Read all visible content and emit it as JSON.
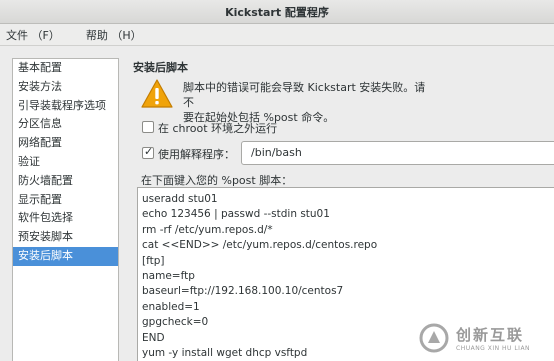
{
  "window": {
    "title": "Kickstart 配置程序"
  },
  "menu": [
    {
      "label": "文件 （F）"
    },
    {
      "label": "帮助 （H）"
    }
  ],
  "sidebar": {
    "items": [
      {
        "label": "基本配置"
      },
      {
        "label": "安装方法"
      },
      {
        "label": "引导装载程序选项"
      },
      {
        "label": "分区信息"
      },
      {
        "label": "网络配置"
      },
      {
        "label": "验证"
      },
      {
        "label": "防火墙配置"
      },
      {
        "label": "显示配置"
      },
      {
        "label": "软件包选择"
      },
      {
        "label": "预安装脚本"
      },
      {
        "label": "安装后脚本"
      }
    ],
    "selected_index": 10
  },
  "panel": {
    "title": "安装后脚本",
    "warning": {
      "line1": "脚本中的错误可能会导致 Kickstart 安装失败。请不",
      "line2": "要在起始处包括 %post 命令。"
    },
    "chroot": {
      "label": "在 chroot 环境之外运行",
      "checked": false
    },
    "interpreter": {
      "label": "使用解释程序：",
      "checked": true,
      "value": "/bin/bash"
    },
    "script_label": "在下面键入您的 %post 脚本：",
    "script_lines": [
      "useradd stu01",
      "echo 123456 | passwd --stdin stu01",
      "rm -rf /etc/yum.repos.d/*",
      "cat <<END>> /etc/yum.repos.d/centos.repo",
      "[ftp]",
      "name=ftp",
      "baseurl=ftp://192.168.100.10/centos7",
      "enabled=1",
      "gpgcheck=0",
      "END",
      "yum -y install wget dhcp vsftpd"
    ]
  },
  "watermark": {
    "name": "创新互联",
    "sub": "CHUANG XIN HU LIAN"
  },
  "colors": {
    "selection": "#4a90d9",
    "warning": "#f0a30a"
  }
}
